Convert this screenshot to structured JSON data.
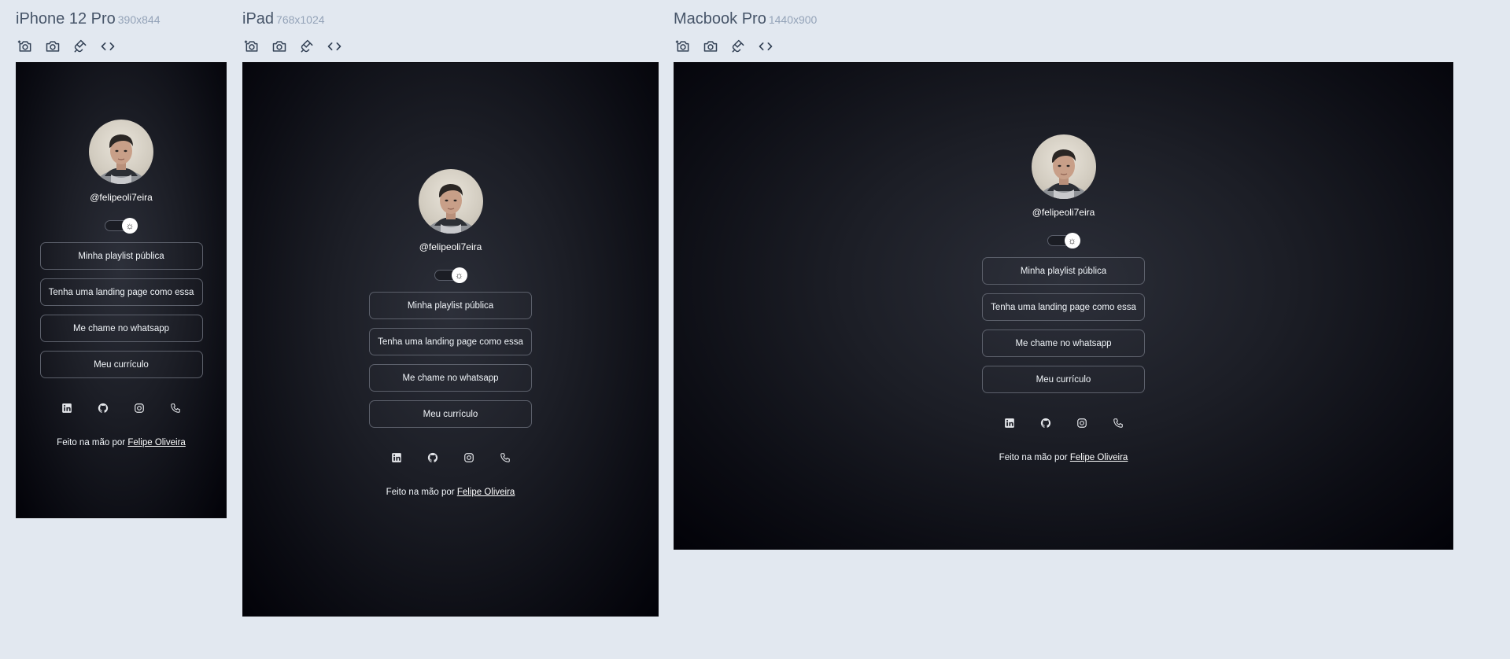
{
  "devices": [
    {
      "name": "iPhone 12 Pro",
      "size": "390x844"
    },
    {
      "name": "iPad",
      "size": "768x1024"
    },
    {
      "name": "Macbook Pro",
      "size": "1440x900"
    }
  ],
  "toolbar_icons": [
    "camera-screenshot-icon",
    "camera-icon",
    "plug-icon",
    "code-icon"
  ],
  "profile": {
    "handle": "@felipeoli7eira",
    "theme_toggle_icon": "sun-icon"
  },
  "links": [
    "Minha playlist pública",
    "Tenha uma landing page como essa",
    "Me chame no whatsapp",
    "Meu currículo"
  ],
  "socials": [
    "linkedin-icon",
    "github-icon",
    "instagram-icon",
    "phone-icon"
  ],
  "footer": {
    "text": "Feito na mão por",
    "author": "Felipe Oliveira"
  },
  "colors": {
    "page_bg": "#e2e8f0",
    "frame_bg": "#1c1e26",
    "button_border": "#5c606b",
    "text": "#f1f5f9"
  }
}
